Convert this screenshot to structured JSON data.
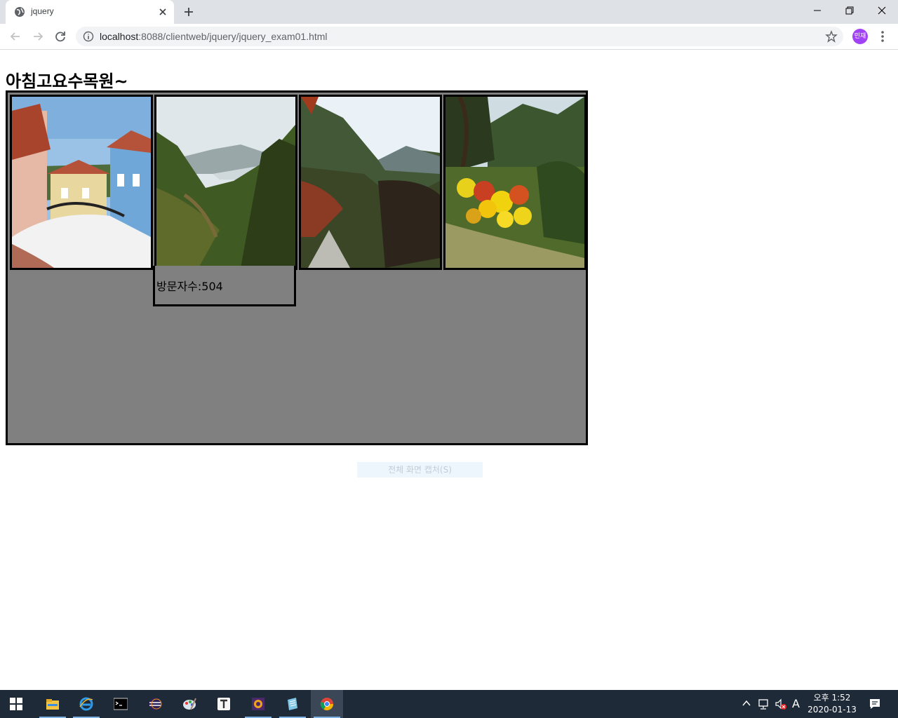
{
  "browser": {
    "tab_title": "jquery",
    "url_host": "localhost",
    "url_rest": ":8088/clientweb/jquery/jquery_exam01.html",
    "profile_label": "민재"
  },
  "page": {
    "heading": "아침고요수목원~",
    "photos": [
      {
        "subject": "european-village-rooftops"
      },
      {
        "subject": "mountain-lake-forest"
      },
      {
        "subject": "autumn-mountain-valley"
      },
      {
        "subject": "chrysanthemum-garden"
      }
    ],
    "visitor_caption": "방문자수:504",
    "capture_tooltip": "전체 화면 캡처(S)"
  },
  "taskbar": {
    "apps": [
      {
        "icon": "file-explorer-icon",
        "active": false
      },
      {
        "icon": "internet-explorer-icon",
        "active": false
      },
      {
        "icon": "command-prompt-icon",
        "active": false
      },
      {
        "icon": "eclipse-icon",
        "active": false
      },
      {
        "icon": "paint-palette-icon",
        "active": false
      },
      {
        "icon": "typora-icon",
        "active": false
      },
      {
        "icon": "sql-tool-icon",
        "active": false
      },
      {
        "icon": "notepad-icon",
        "active": false
      },
      {
        "icon": "chrome-icon",
        "active": true
      }
    ],
    "ime_label": "A",
    "clock_time": "오후 1:52",
    "clock_date": "2020-01-13"
  }
}
